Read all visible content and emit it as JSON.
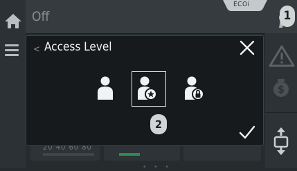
{
  "topbar": {
    "mode": "Off",
    "eco_label": "ECOi",
    "badge": "1"
  },
  "dialog": {
    "back_symbol": "<",
    "title": "Access Level",
    "levels": [
      {
        "name": "user"
      },
      {
        "name": "expert",
        "selected": true
      },
      {
        "name": "locked"
      }
    ],
    "step_badge": "2"
  },
  "background": {
    "numbers": "20 40 60 80"
  },
  "colors": {
    "accent_green": "#2f8a53",
    "dialog_bg": "#161a1c"
  }
}
